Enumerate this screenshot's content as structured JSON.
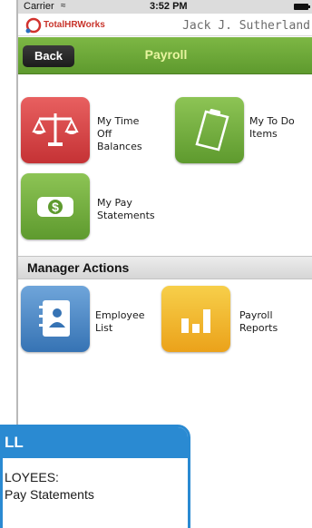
{
  "status_bar": {
    "carrier": "Carrier",
    "time": "3:52 PM"
  },
  "brand": {
    "logo_text": "TotalHRWorks",
    "user_name": "Jack J. Sutherland"
  },
  "nav": {
    "back_label": "Back",
    "title": "Payroll"
  },
  "tiles": [
    {
      "label": "My Time Off\nBalances",
      "icon": "scales-icon",
      "color": "#d44446"
    },
    {
      "label": "My To Do\nItems",
      "icon": "clipboard-icon",
      "color": "#6ea83a"
    },
    {
      "label": "My Pay\nStatements",
      "icon": "money-icon",
      "color": "#6ea83a"
    }
  ],
  "manager_section": {
    "title": "Manager Actions",
    "tiles": [
      {
        "label": "Employee\nList",
        "icon": "address-book-icon",
        "color": "#4f8cc9"
      },
      {
        "label": "Payroll\nReports",
        "icon": "bar-chart-icon",
        "color": "#f2b830"
      }
    ]
  },
  "overlay": {
    "header": "LL",
    "line1": "LOYEES:",
    "line2": "Pay Statements",
    "line3": ""
  },
  "colors": {
    "accent_green": "#6ea83a",
    "overlay_blue": "#2a8ad2"
  }
}
